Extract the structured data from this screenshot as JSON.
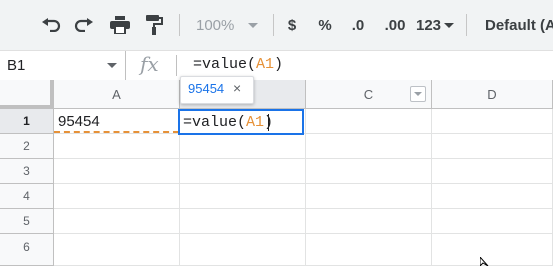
{
  "toolbar": {
    "zoom": "100%",
    "currency": "$",
    "percent": "%",
    "decrease_decimal": ".0",
    "increase_decimal": ".00",
    "more_formats": "123",
    "font": "Default (Ari"
  },
  "formula_bar": {
    "name_box": "B1",
    "fx": "fx",
    "formula_prefix": "=value(",
    "formula_ref": "A1",
    "formula_suffix": ")"
  },
  "grid": {
    "columns": [
      "A",
      "B",
      "C",
      "D"
    ],
    "rows": [
      "1",
      "2",
      "3",
      "4",
      "5",
      "6"
    ],
    "a1_value": "95454",
    "editor": {
      "prefix": "=value(",
      "ref": "A1",
      "suffix": ")"
    },
    "preview_tooltip": {
      "value": "95454",
      "close": "×"
    }
  }
}
